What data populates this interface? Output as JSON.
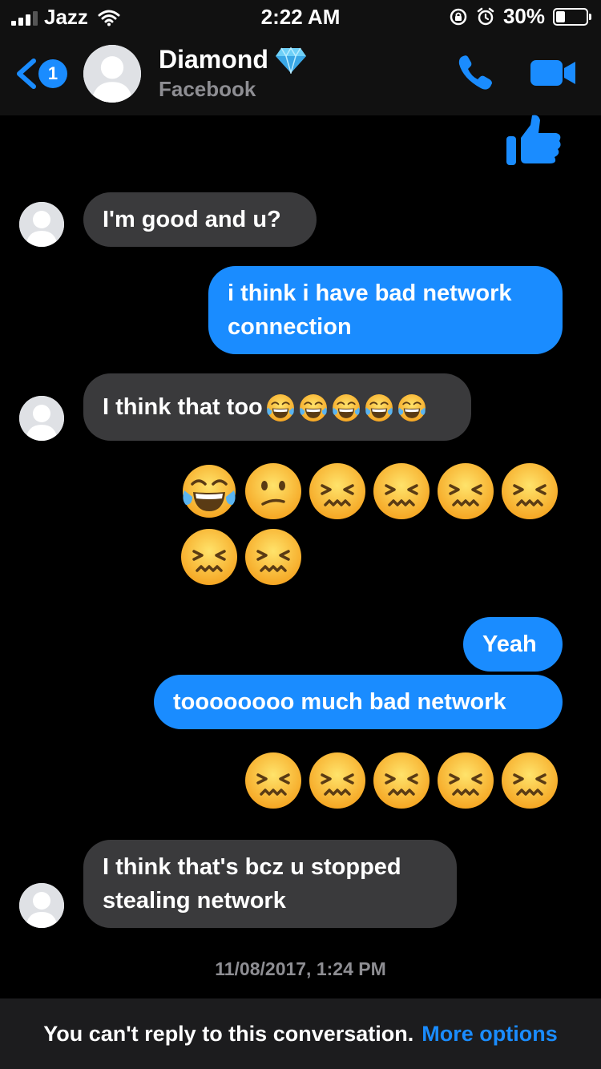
{
  "status_bar": {
    "carrier": "Jazz",
    "time": "2:22 AM",
    "battery": "30%",
    "battery_level": 0.3,
    "icons": [
      "signal-icon",
      "wifi-icon",
      "orientation-lock-icon",
      "alarm-icon",
      "battery-icon"
    ]
  },
  "header": {
    "back_badge": "1",
    "contact_name": "Diamond",
    "subtitle": "Facebook",
    "icons": [
      "back-chevron-icon",
      "diamond-icon",
      "phone-icon",
      "video-camera-icon"
    ]
  },
  "messages": [
    {
      "type": "sticker",
      "from": "me",
      "icon": "thumbs-up-icon"
    },
    {
      "type": "text",
      "from": "them",
      "text": "I'm good and u?"
    },
    {
      "type": "text",
      "from": "me",
      "lines": [
        "i think i have bad network",
        "connection"
      ]
    },
    {
      "type": "text",
      "from": "them",
      "text": "I think that too",
      "emojis": [
        "joy",
        "joy",
        "joy",
        "joy",
        "joy"
      ]
    },
    {
      "type": "emoji",
      "from": "me",
      "emojis": [
        "joy",
        "confused",
        "confounded",
        "confounded",
        "confounded",
        "confounded",
        "confounded",
        "confounded"
      ]
    },
    {
      "type": "text",
      "from": "me",
      "text": "Yeah"
    },
    {
      "type": "text",
      "from": "me",
      "text": "toooooooo much bad network"
    },
    {
      "type": "emoji",
      "from": "me",
      "emojis": [
        "confounded",
        "confounded",
        "confounded",
        "confounded",
        "confounded"
      ]
    },
    {
      "type": "text",
      "from": "them",
      "lines": [
        "I think that's bcz u stopped",
        "stealing network"
      ]
    }
  ],
  "timestamp": "11/08/2017, 1:24 PM",
  "footer": {
    "notice": "You can't reply to this conversation.",
    "link": "More options"
  },
  "colors": {
    "accent": "#1a8cff",
    "incoming_bubble": "#3a3a3c",
    "background": "#000000",
    "emoji_face": "#f8c43a"
  }
}
